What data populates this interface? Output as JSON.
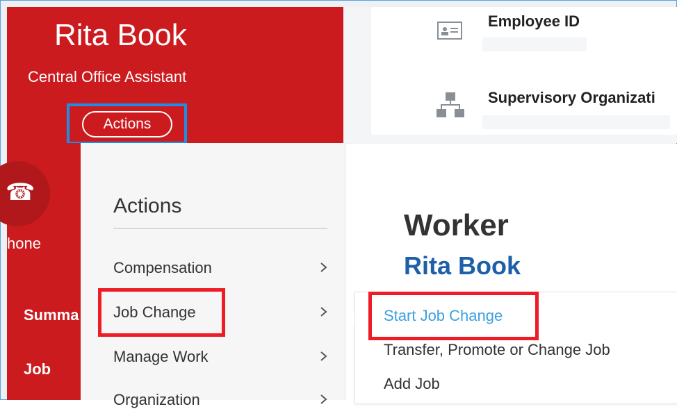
{
  "profile": {
    "name": "Rita Book",
    "role": "Central Office Assistant",
    "actions_button": "Actions"
  },
  "info": {
    "employee_id_label": "Employee ID",
    "supervisory_org_label": "Supervisory Organizati"
  },
  "left_nav": {
    "phone_icon": "☎",
    "phone_label": "hone",
    "items": [
      "Summa",
      "Job"
    ]
  },
  "actions_menu": {
    "title": "Actions",
    "items": [
      "Compensation",
      "Job Change",
      "Manage Work",
      "Organization"
    ]
  },
  "worker_panel": {
    "title": "Worker",
    "name": "Rita Book"
  },
  "job_change_submenu": {
    "items": [
      "Start Job Change",
      "Transfer, Promote or Change Job",
      "Add Job"
    ]
  },
  "colors": {
    "brand_red": "#cc1b1f",
    "link_blue": "#3ca0e0",
    "name_blue": "#1d5fa8",
    "highlight_red": "#ee1c25",
    "highlight_blue": "#1e8de8"
  }
}
